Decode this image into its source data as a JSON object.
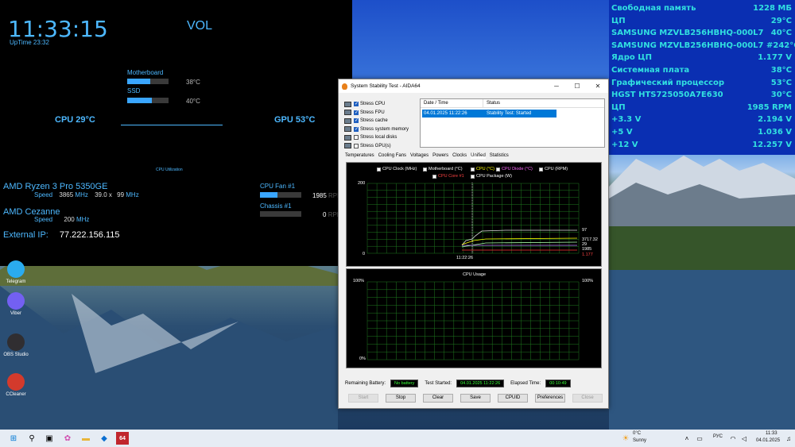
{
  "overlay_left": {
    "clock": "11:33:15",
    "uptime": "UpTime 23:32",
    "vol": "VOL",
    "motherboard": {
      "label": "Motherboard",
      "temp": "38°C",
      "level": 0.55
    },
    "ssd": {
      "label": "SSD",
      "temp": "40°C",
      "level": 0.6
    },
    "cpu_temp": "CPU 29°C",
    "gpu_temp": "GPU 53°C",
    "cpu_util": "CPU Utilization",
    "cpu_name": "AMD Ryzen 3 Pro 5350GE",
    "cpu_speed_label": "Speed",
    "cpu_speed": "3865",
    "cpu_mhz": "MHz",
    "cpu_mult": "39.0 x",
    "cpu_bus": "99",
    "cpu_bus_mhz": "MHz",
    "gpu_name": "AMD Cezanne",
    "gpu_speed_label": "Speed",
    "gpu_speed": "200",
    "gpu_mhz": "MHz",
    "ext_ip_label": "External IP:",
    "ext_ip": "77.222.156.115",
    "cpu_fan": {
      "label": "CPU Fan #1",
      "value": "1985",
      "unit": "RPM",
      "level": 0.42
    },
    "chassis": {
      "label": "Chassis #1",
      "value": "0",
      "unit": "RPM",
      "level": 0
    }
  },
  "sensors": [
    {
      "k": "Свободная память",
      "v": "1228 МБ"
    },
    {
      "k": "ЦП",
      "v": "29°C"
    },
    {
      "k": "SAMSUNG MZVLB256HBHQ-000L7",
      "v": "40°C"
    },
    {
      "k": "SAMSUNG MZVLB256HBHQ-000L7 #2",
      "v": "42°C"
    },
    {
      "k": "Ядро ЦП",
      "v": "1.177 V"
    },
    {
      "k": "Системная плата",
      "v": "38°C"
    },
    {
      "k": "Графический процессор",
      "v": "53°C"
    },
    {
      "k": "HGST HTS725050A7E630",
      "v": "30°C"
    },
    {
      "k": "ЦП",
      "v": "1985 RPM"
    },
    {
      "k": "+3.3 V",
      "v": "2.194 V"
    },
    {
      "k": "+5 V",
      "v": "1.036 V"
    },
    {
      "k": "+12 V",
      "v": "12.257 V"
    }
  ],
  "desktop_icons": [
    {
      "label": "Telegram",
      "color": "#2aabee"
    },
    {
      "label": "Viber",
      "color": "#7360f2"
    },
    {
      "label": "OBS Studio",
      "color": "#302e31"
    },
    {
      "label": "CCleaner",
      "color": "#d33a2c"
    }
  ],
  "aida": {
    "title": "System Stability Test - AIDA64",
    "options": [
      {
        "label": "Stress CPU",
        "checked": true
      },
      {
        "label": "Stress FPU",
        "checked": true
      },
      {
        "label": "Stress cache",
        "checked": true
      },
      {
        "label": "Stress system memory",
        "checked": true
      },
      {
        "label": "Stress local disks",
        "checked": false
      },
      {
        "label": "Stress GPU(s)",
        "checked": false
      }
    ],
    "table": {
      "col1": "Date / Time",
      "col2": "Status",
      "row_date": "04.01.2025 11:22:26",
      "row_status": "Stability Test: Started"
    },
    "tabs": [
      "Temperatures",
      "Cooling Fans",
      "Voltages",
      "Powers",
      "Clocks",
      "Unified",
      "Statistics"
    ],
    "active_tab": "Unified",
    "legend1": [
      "CPU Clock (MHz)",
      "Motherboard (°C)",
      "CPU (°C)",
      "CPU Diode (°C)",
      "CPU (RPM)"
    ],
    "legend2": [
      "CPU Core #1",
      "CPU Package (W)"
    ],
    "legend_colors": [
      "#ffffff",
      "#e8e8e8",
      "#ffff00",
      "#ff00ff",
      "#ffffff",
      "#ff3333",
      "#ffffff"
    ],
    "graph1_top": "200",
    "graph1_bottom": "0",
    "graph1_time": "11:22:26",
    "graph1_right": [
      "97",
      "3717.32",
      "29",
      "1985",
      "1.177"
    ],
    "graph2_title": "CPU Usage",
    "graph2_top_l": "100%",
    "graph2_top_r": "100%",
    "graph2_bottom": "0%",
    "remaining_battery_label": "Remaining Battery:",
    "remaining_battery": "No battery",
    "test_started_label": "Test Started:",
    "test_started": "04.01.2025 11:22:26",
    "elapsed_label": "Elapsed Time:",
    "elapsed": "00:10:49",
    "buttons": {
      "start": "Start",
      "stop": "Stop",
      "clear": "Clear",
      "save": "Save",
      "cpuid": "CPUID",
      "preferences": "Preferences",
      "close": "Close"
    }
  },
  "taskbar": {
    "weather_temp": "0°C",
    "weather_text": "Sunny",
    "lang": "РУС",
    "time": "11:33",
    "date": "04.01.2025",
    "app_label": "64"
  }
}
